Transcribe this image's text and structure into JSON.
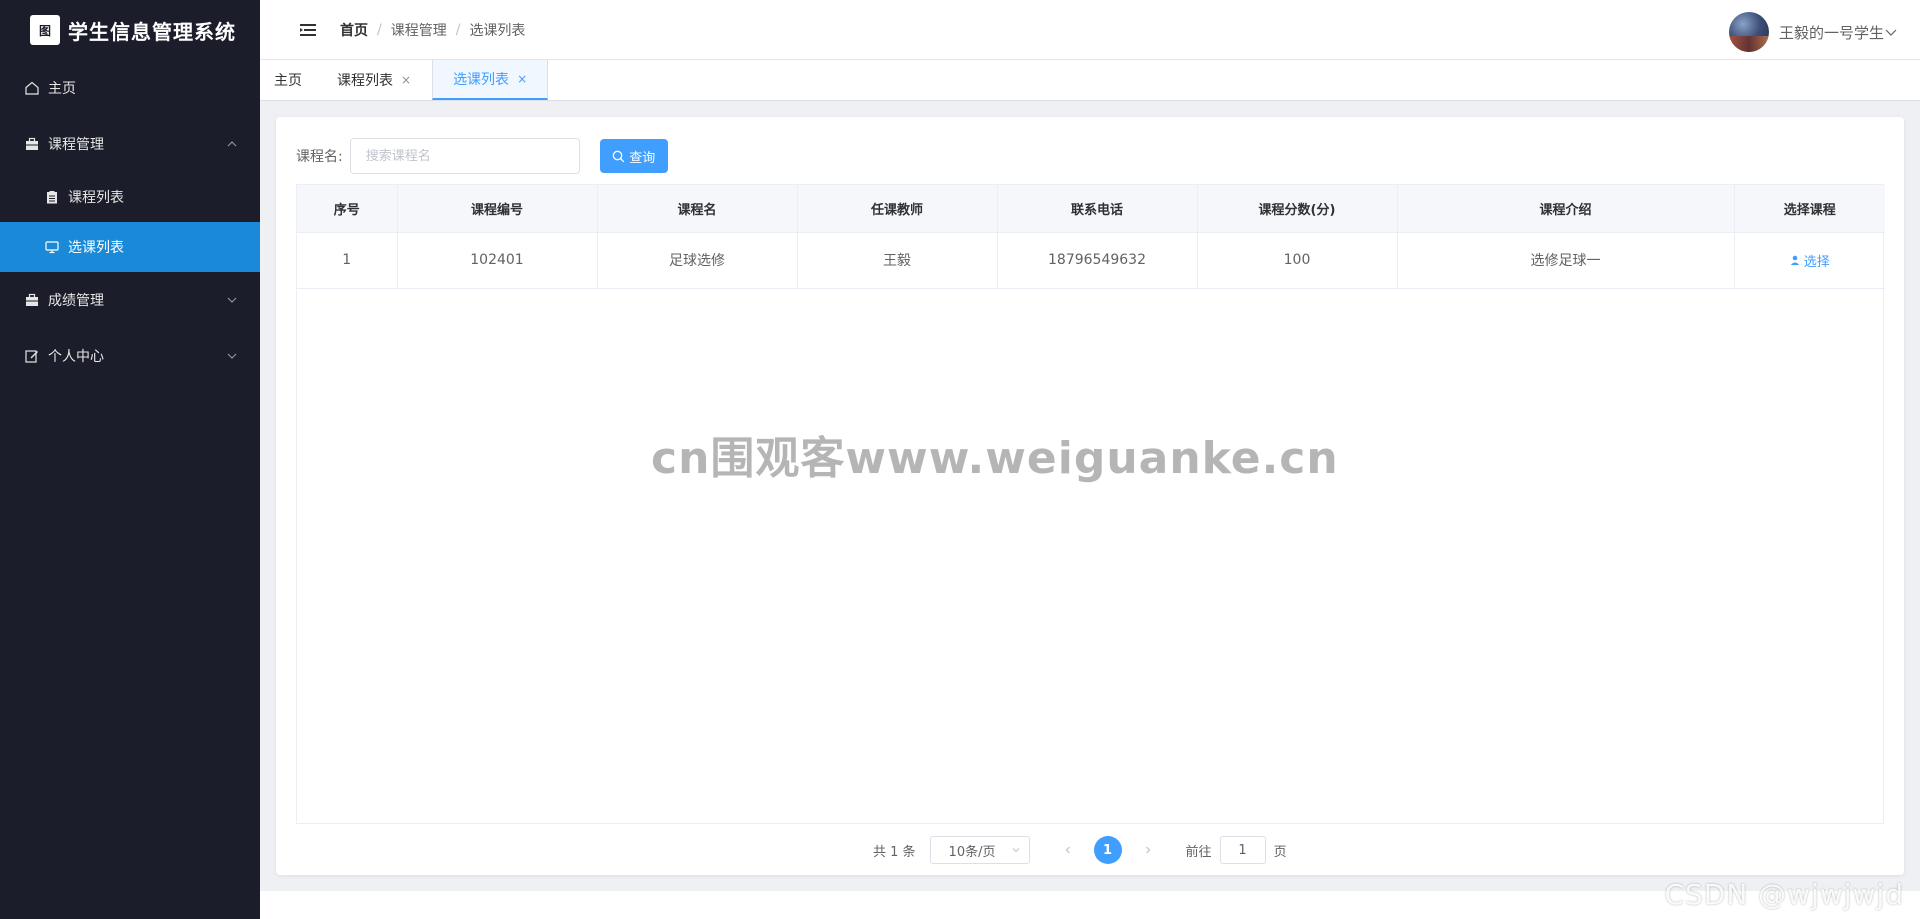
{
  "app": {
    "logo_mark": "图",
    "title": "学生信息管理系统"
  },
  "sidebar": {
    "items": [
      {
        "label": "主页",
        "icon": "home-icon"
      },
      {
        "label": "课程管理",
        "icon": "briefcase-icon",
        "expanded": true,
        "children": [
          {
            "label": "课程列表",
            "icon": "clipboard-icon"
          },
          {
            "label": "选课列表",
            "icon": "monitor-icon",
            "active": true
          }
        ]
      },
      {
        "label": "成绩管理",
        "icon": "briefcase-icon",
        "expanded": false
      },
      {
        "label": "个人中心",
        "icon": "edit-icon",
        "expanded": false
      }
    ]
  },
  "header": {
    "breadcrumb": [
      "首页",
      "课程管理",
      "选课列表"
    ],
    "user_name": "王毅的一号学生"
  },
  "tabs": [
    {
      "label": "主页",
      "closable": false
    },
    {
      "label": "课程列表",
      "closable": true
    },
    {
      "label": "选课列表",
      "closable": true,
      "active": true
    }
  ],
  "tab_close_glyph": "×",
  "search": {
    "label": "课程名:",
    "placeholder": "搜索课程名",
    "button_label": "查询"
  },
  "table": {
    "columns": [
      "序号",
      "课程编号",
      "课程名",
      "任课教师",
      "联系电话",
      "课程分数(分)",
      "课程介绍",
      "选择课程"
    ],
    "rows": [
      {
        "index": "1",
        "code": "102401",
        "name": "足球选修",
        "teacher": "王毅",
        "phone": "18796549632",
        "score": "100",
        "intro": "选修足球一",
        "action": "选择"
      }
    ]
  },
  "pagination": {
    "total": "共 1 条",
    "page_size": "10条/页",
    "current_page": "1",
    "jump_label": "前往",
    "jump_value": "1",
    "jump_suffix": "页"
  },
  "watermark": "cn围观客www.weiguanke.cn",
  "corner_watermark": "CSDN @wjwjwjd",
  "colors": {
    "sidebar_bg": "#1b1d2a",
    "active_menu": "#1a8ad8",
    "primary": "#409eff"
  }
}
